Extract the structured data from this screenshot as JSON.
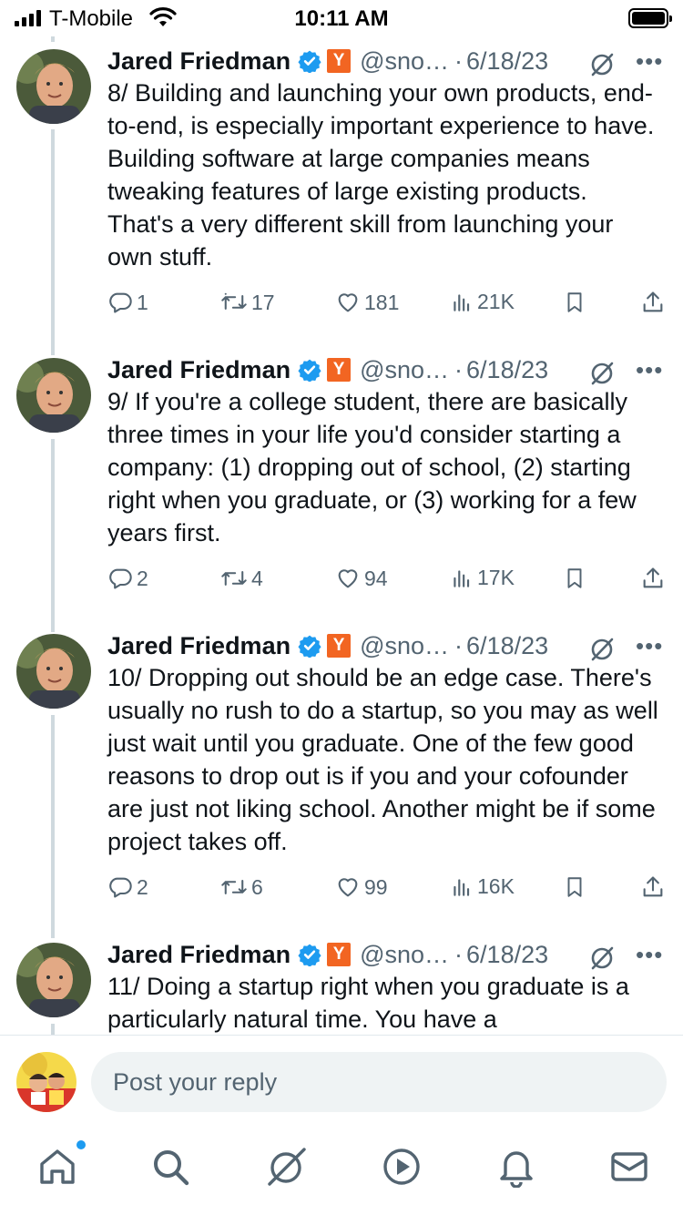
{
  "status": {
    "carrier": "T-Mobile",
    "time": "10:11 AM"
  },
  "tweets": [
    {
      "name": "Jared Friedman",
      "badge": "Y",
      "handle": "@sno…",
      "sep": "·",
      "date": "6/18/23",
      "text": "8/ Building and launching your own products, end-to-end, is especially important experience to have.  Building software at large companies means tweaking features of large existing products.  That's a very different skill from launching your own stuff.",
      "replies": "1",
      "reposts": "17",
      "likes": "181",
      "views": "21K"
    },
    {
      "name": "Jared Friedman",
      "badge": "Y",
      "handle": "@sno…",
      "sep": "·",
      "date": "6/18/23",
      "text": "9/ If you're a college student, there are basically three times in your life you'd consider starting a company: (1) dropping out of school, (2) starting right when you graduate, or (3) working for a few years first.",
      "replies": "2",
      "reposts": "4",
      "likes": "94",
      "views": "17K"
    },
    {
      "name": "Jared Friedman",
      "badge": "Y",
      "handle": "@sno…",
      "sep": "·",
      "date": "6/18/23",
      "text": "10/ Dropping out should be an edge case.  There's usually no rush to do a startup, so you may as well just wait until you graduate.  One of the few good reasons to drop out is if you and your cofounder are just not liking school.  Another might be if some project takes off.",
      "replies": "2",
      "reposts": "6",
      "likes": "99",
      "views": "16K"
    },
    {
      "name": "Jared Friedman",
      "badge": "Y",
      "handle": "@sno…",
      "sep": "·",
      "date": "6/18/23",
      "text": "11/ Doing a startup right when you graduate is a particularly natural time.  You have a"
    }
  ],
  "composer": {
    "placeholder": "Post your reply"
  },
  "tabs": [
    "home-icon",
    "search-icon",
    "grok-icon",
    "video-icon",
    "notifications-icon",
    "messages-icon"
  ],
  "colors": {
    "accent": "#1d9bf0",
    "ycombinator": "#f26522",
    "muted": "#536471"
  }
}
